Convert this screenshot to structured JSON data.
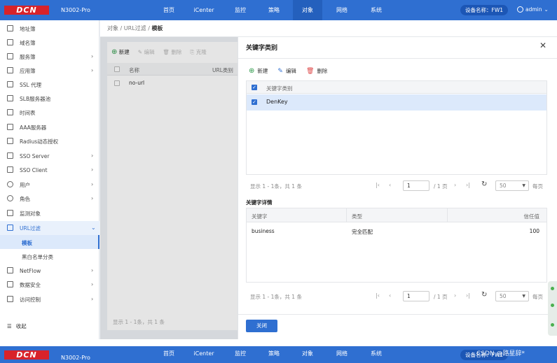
{
  "header": {
    "logo": "DCN",
    "model": "N3002-Pro",
    "nav": [
      "首页",
      "iCenter",
      "监控",
      "策略",
      "对象",
      "网络",
      "系统"
    ],
    "active_nav": "对象",
    "device_label": "设备名称：FW1",
    "user": "admin"
  },
  "sidebar": {
    "items": [
      {
        "label": "地址簿",
        "arrow": ""
      },
      {
        "label": "域名簿",
        "arrow": ""
      },
      {
        "label": "服务簿",
        "arrow": "›"
      },
      {
        "label": "应用簿",
        "arrow": "›"
      },
      {
        "label": "SSL 代理",
        "arrow": ""
      },
      {
        "label": "SLB服务器池",
        "arrow": ""
      },
      {
        "label": "时间表",
        "arrow": ""
      },
      {
        "label": "AAA服务器",
        "arrow": ""
      },
      {
        "label": "Radius动态授权",
        "arrow": ""
      },
      {
        "label": "SSO Server",
        "arrow": "›"
      },
      {
        "label": "SSO Client",
        "arrow": "›"
      },
      {
        "label": "用户",
        "arrow": "›"
      },
      {
        "label": "角色",
        "arrow": "›"
      },
      {
        "label": "监测对象",
        "arrow": ""
      },
      {
        "label": "URL过滤",
        "arrow": "⌄"
      }
    ],
    "sub_items": [
      "模板",
      "黑白名单分类"
    ],
    "items_after": [
      {
        "label": "NetFlow",
        "arrow": "›"
      },
      {
        "label": "数据安全",
        "arrow": "›"
      },
      {
        "label": "访问控制",
        "arrow": "›"
      }
    ],
    "collapse_label": "收起"
  },
  "breadcrumb": {
    "path": "对象 / URL过滤 / ",
    "current": "模板"
  },
  "background_panel": {
    "toolbar": [
      "新建",
      "编辑",
      "删除",
      "克隆"
    ],
    "columns": [
      "名称",
      "URL类别"
    ],
    "rows": [
      "no-url"
    ],
    "footer": "显示 1 - 1条，共 1 条"
  },
  "drawer": {
    "title": "关键字类别",
    "close_icon": "close-icon",
    "toolbar": {
      "new": "新建",
      "edit": "编辑",
      "delete": "删除"
    },
    "category_table": {
      "header": "关键字类别",
      "rows": [
        "DenKey"
      ]
    },
    "pager1": {
      "info": "显示 1 - 1条，共 1 条",
      "page": "1",
      "pages": "/ 1 页",
      "page_size": "50",
      "per_page": "每页"
    },
    "detail_title": "关键字详情",
    "detail_table": {
      "headers": [
        "关键字",
        "类型",
        "信任值"
      ],
      "rows": [
        {
          "keyword": "business",
          "type": "完全匹配",
          "trust": "100"
        }
      ]
    },
    "pager2": {
      "info": "显示 1 - 1条，共 1 条",
      "page": "1",
      "pages": "/ 1 页",
      "page_size": "50",
      "per_page": "每页"
    },
    "close_button": "关闭"
  },
  "watermark": "CSDN @路星辞*",
  "colors": {
    "primary": "#2f6fd1",
    "logo_red": "#d8232a",
    "selected_row": "#dce9fb"
  }
}
